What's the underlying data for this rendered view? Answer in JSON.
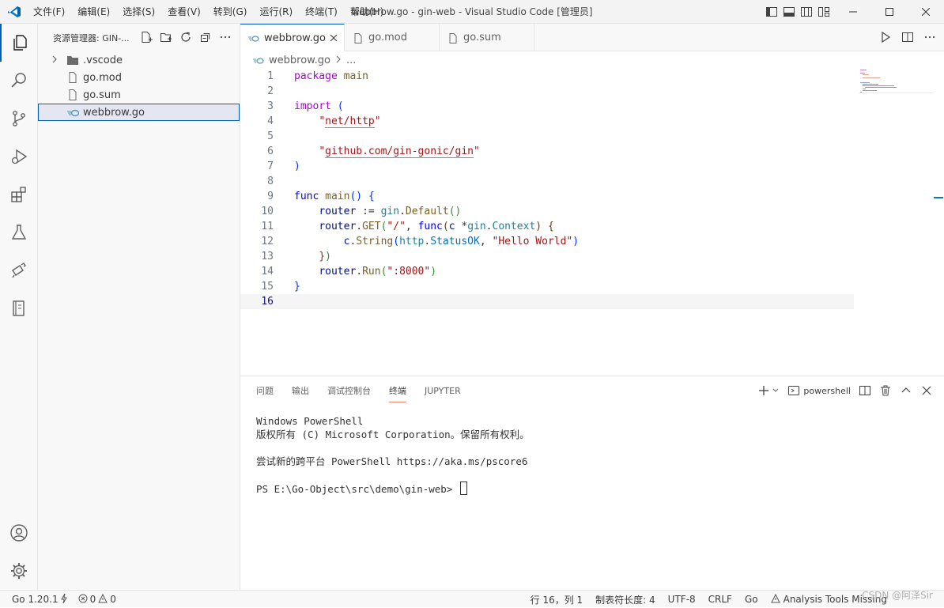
{
  "titlebar": {
    "menus": [
      "文件(F)",
      "编辑(E)",
      "选择(S)",
      "查看(V)",
      "转到(G)",
      "运行(R)",
      "终端(T)",
      "帮助(H)"
    ],
    "title": "webbrow.go - gin-web - Visual Studio Code [管理员]"
  },
  "sidebar": {
    "header": "资源管理器: GIN-...",
    "tree": [
      {
        "label": ".vscode",
        "type": "folder"
      },
      {
        "label": "go.mod",
        "type": "file"
      },
      {
        "label": "go.sum",
        "type": "file"
      },
      {
        "label": "webbrow.go",
        "type": "go-file",
        "selected": true
      }
    ]
  },
  "tabs": [
    {
      "label": "webbrow.go",
      "active": true
    },
    {
      "label": "go.mod",
      "active": false
    },
    {
      "label": "go.sum",
      "active": false
    }
  ],
  "breadcrumb": {
    "file": "webbrow.go",
    "more": "..."
  },
  "code": {
    "line_numbers": [
      "1",
      "2",
      "3",
      "4",
      "5",
      "6",
      "7",
      "8",
      "9",
      "10",
      "11",
      "12",
      "13",
      "14",
      "15",
      "16"
    ],
    "current_line": "16"
  },
  "panel": {
    "tabs": [
      "问题",
      "输出",
      "调试控制台",
      "终端",
      "JUPYTER"
    ],
    "active_tab": "终端",
    "shell": "powershell",
    "terminal_lines": [
      "Windows PowerShell",
      "版权所有 (C) Microsoft Corporation。保留所有权利。",
      "",
      "尝试新的跨平台 PowerShell https://aka.ms/pscore6",
      "",
      "PS E:\\Go-Object\\src\\demo\\gin-web> "
    ]
  },
  "statusbar": {
    "go_version": "Go 1.20.1",
    "errors": "0",
    "warnings": "0",
    "position": "行 16，列 1",
    "tab_size": "制表符长度: 4",
    "encoding": "UTF-8",
    "eol": "CRLF",
    "language": "Go",
    "analysis": "Analysis Tools Missing"
  },
  "watermark": "CSDN @阿泽Sir",
  "colors": {
    "accent": "#005fb8",
    "keyword": "#af00db",
    "string": "#a31515",
    "func": "#795e26",
    "type": "#267f99"
  }
}
